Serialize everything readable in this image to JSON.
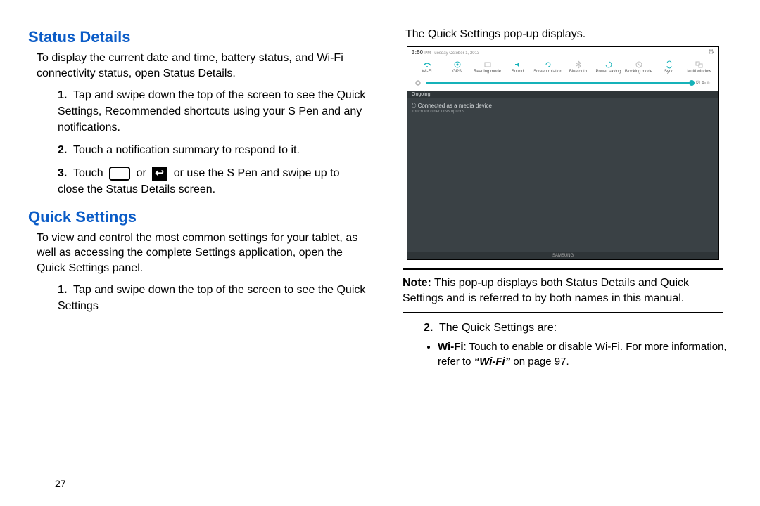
{
  "left": {
    "heading1": "Status Details",
    "lead1": "To display the current date and time, battery status, and Wi-Fi connectivity status, open Status Details.",
    "list1": [
      "Tap and swipe down the top of the screen to see the Quick Settings, Recommended shortcuts using your S Pen and any notifications.",
      "Touch a notification summary to respond to it.",
      "Touch  or  or use the S Pen and swipe up to close the Status Details screen."
    ],
    "item3_pre": "Touch",
    "item3_or": "or",
    "item3_post": "or use the S Pen and swipe up to close the Status Details screen.",
    "heading2": "Quick Settings",
    "lead2": "To view and control the most common settings for your tablet, as well as accessing the complete Settings application, open the Quick Settings panel.",
    "list2": [
      "Tap and swipe down the top of the screen to see the Quick Settings"
    ]
  },
  "right": {
    "caption": "The Quick Settings pop-up displays.",
    "note_label": "Note:",
    "note_text": " This pop-up displays both Status Details and Quick Settings and is referred to by both names in this manual.",
    "item2": "The Quick Settings are:",
    "bullet_wifi_bold": "Wi-Fi",
    "bullet_wifi_rest": ": Touch to enable or disable Wi-Fi. For more information, refer to ",
    "bullet_wifi_xref": "“Wi-Fi”",
    "bullet_wifi_tail": " on page 97."
  },
  "shot": {
    "time": "3:50",
    "date_small": "PM  Tuesday  October 1, 2013",
    "gear": "⚙",
    "toggles": [
      "Wi-Fi",
      "GPS",
      "Reading mode",
      "Sound",
      "Screen rotation",
      "Bluetooth",
      "Power saving",
      "Blocking mode",
      "Sync",
      "Multi window"
    ],
    "auto": "Auto",
    "panel_header": "Ongoing",
    "panel_line": "Connected as a media device",
    "panel_sub": "Touch for other USB options",
    "panel_footer": "SAMSUNG"
  },
  "page": "27"
}
